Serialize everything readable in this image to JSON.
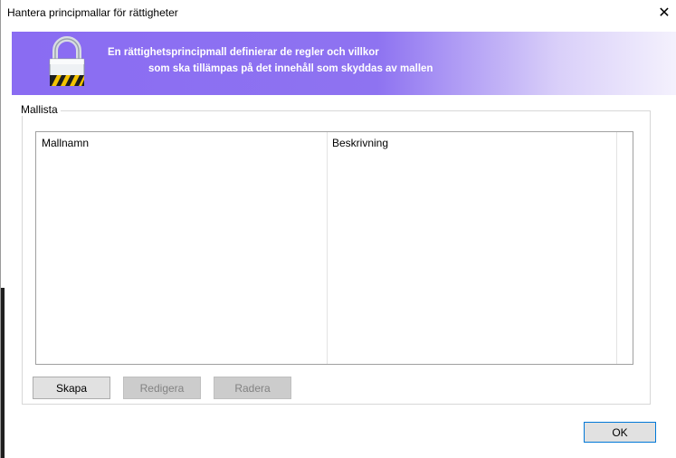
{
  "window": {
    "title": "Hantera principmallar för rättigheter",
    "close_glyph": "✕"
  },
  "banner": {
    "icon": "padlock-icon",
    "line1": "En rättighetsprincipmall definierar de regler och villkor",
    "line2": "som ska tillämpas på det innehåll som skyddas av mallen",
    "gradient_start": "#8a6cf2"
  },
  "template_list": {
    "group_label": "Mallista",
    "columns": [
      "Mallnamn",
      "Beskrivning"
    ],
    "rows": []
  },
  "buttons": {
    "create": "Skapa",
    "edit": "Redigera",
    "delete": "Radera",
    "ok": "OK"
  },
  "colors": {
    "accent": "#0078d7",
    "button_bg": "#e1e1e1",
    "disabled_text": "#838383"
  }
}
